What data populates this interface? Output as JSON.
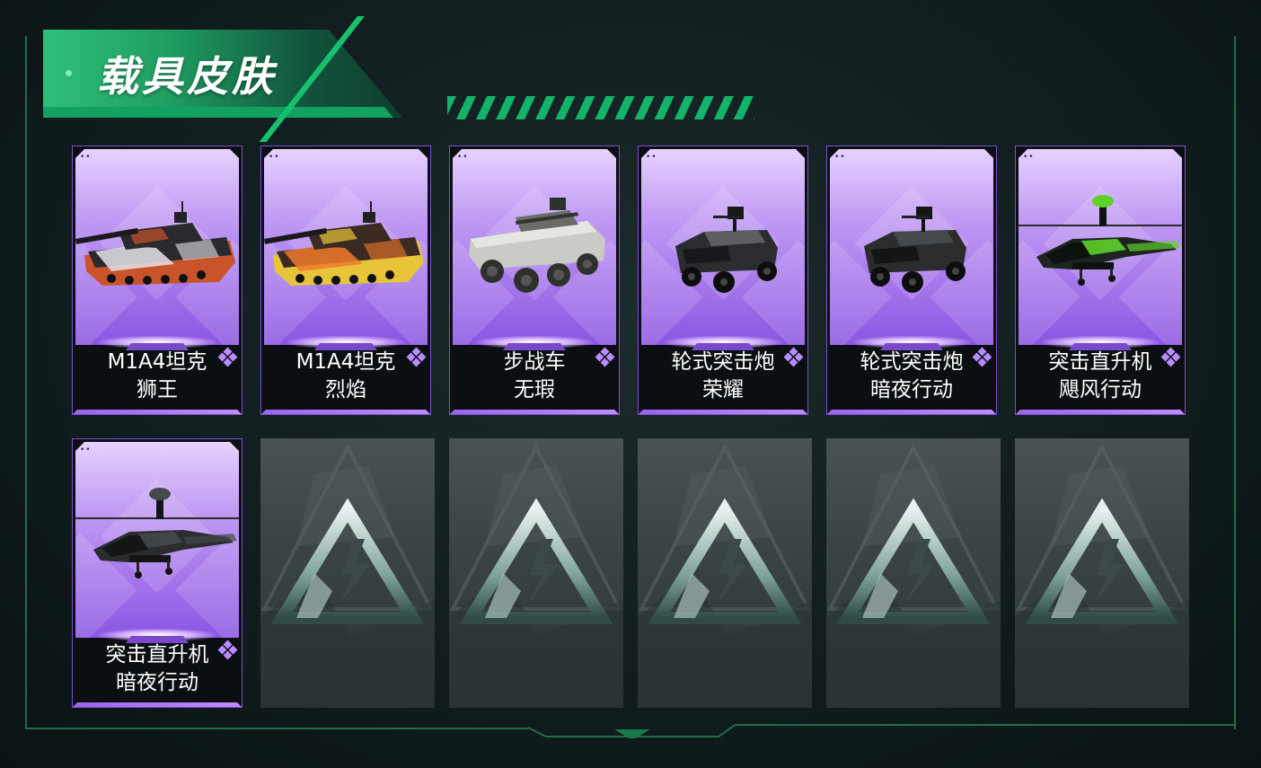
{
  "header": {
    "title": "载具皮肤"
  },
  "skins": [
    {
      "name": "M1A4坦克",
      "variant": "狮王",
      "vehicle_type": "tank",
      "paint": "lion"
    },
    {
      "name": "M1A4坦克",
      "variant": "烈焰",
      "vehicle_type": "tank",
      "paint": "flame"
    },
    {
      "name": "步战车",
      "variant": "无瑕",
      "vehicle_type": "ifv",
      "paint": "flawless"
    },
    {
      "name": "轮式突击炮",
      "variant": "荣耀",
      "vehicle_type": "assault-car",
      "paint": "glory"
    },
    {
      "name": "轮式突击炮",
      "variant": "暗夜行动",
      "vehicle_type": "assault-car",
      "paint": "night"
    },
    {
      "name": "突击直升机",
      "variant": "飓风行动",
      "vehicle_type": "helicopter",
      "paint": "hurricane"
    },
    {
      "name": "突击直升机",
      "variant": "暗夜行动",
      "vehicle_type": "helicopter",
      "paint": "night"
    }
  ],
  "locked_slots": 5,
  "colors": {
    "accent": "#16c06e",
    "card_purple": "#9d6ae8",
    "background": "#111d1e"
  },
  "icons": {
    "rarity": "diamond-gem-icon",
    "locked": "triangle-bolt-logo-icon"
  }
}
